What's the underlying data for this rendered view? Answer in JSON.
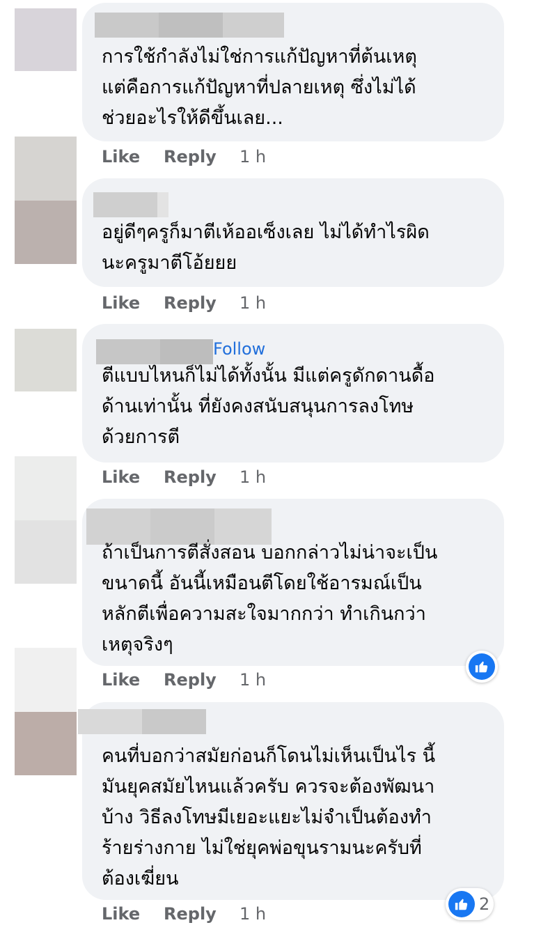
{
  "actions": {
    "like": "Like",
    "reply": "Reply"
  },
  "follow_label": "Follow",
  "comments": [
    {
      "text": "การใช้กำลังไม่ใช่การแก้ปัญหาที่ต้นเหตุ\nแต่คือการแก้ปัญหาที่ปลายเหตุ ซึ่งไม่ได้\nช่วยอะไรให้ดีขึ้นเลย...",
      "time": "1 h"
    },
    {
      "text": "อยู่ดีๆครูก็มาตีเห้ออเซ็งเลย ไม่ได้ทำไรผิด\nนะครูมาตีโอ้ยยย",
      "time": "1 h"
    },
    {
      "text": "ตีแบบไหนก็ไม่ได้ทั้งนั้น มีแต่ครูดักดานดื้อ\nด้านเท่านั้น ที่ยังคงสนับสนุนการลงโทษ\nด้วยการตี",
      "time": "1 h"
    },
    {
      "text": "ถ้าเป็นการตีสั่งสอน บอกกล่าวไม่น่าจะเป็น\nขนาดนี้ อันนี้เหมือนตีโดยใช้อารมณ์เป็น\nหลักตีเพื่อความสะใจมากกว่า ทำเกินกว่า\nเหตุจริงๆ",
      "time": "1 h"
    },
    {
      "text": "คนที่บอกว่าสมัยก่อนก็โดนไม่เห็นเป็นไร นี้\nมันยุคสมัยไหนแล้วครับ ควรจะต้องพัฒนา\nบ้าง วิธีลงโทษมีเยอะแยะไม่จำเป็นต้องทำ\nร้ายร่างกาย ไม่ใช่ยุคพ่อขุนรามนะครับที่\nต้องเฆี่ยน",
      "time": "1 h",
      "reaction_count": "2"
    }
  ],
  "colors": {
    "bubble": "#f0f2f5",
    "link": "#216fdb",
    "muted": "#65676b",
    "like_blue": "#1877f2"
  }
}
